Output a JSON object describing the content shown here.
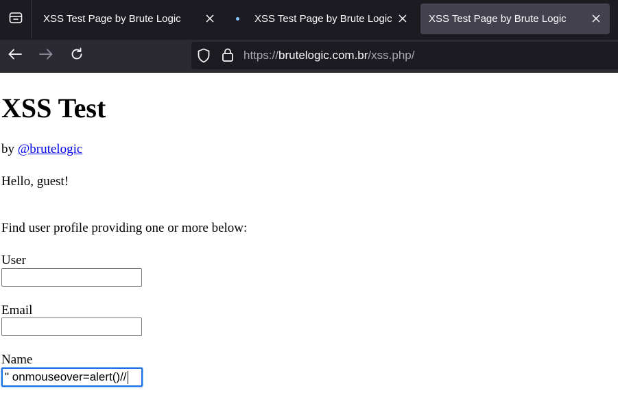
{
  "browser": {
    "tabs": [
      {
        "title": "XSS Test Page by Brute Logic",
        "active": false
      },
      {
        "title": "XSS Test Page by Brute Logic",
        "active": false
      },
      {
        "title": "XSS Test Page by Brute Logic",
        "active": true
      }
    ],
    "url": {
      "scheme": "https://",
      "host": "brutelogic.com.br",
      "path": "/xss.php/"
    }
  },
  "page": {
    "heading": "XSS Test",
    "by_prefix": "by ",
    "author_link": "@brutelogic",
    "greeting": "Hello, guest!",
    "instructions": "Find user profile providing one or more below:",
    "fields": {
      "user": {
        "label": "User",
        "value": ""
      },
      "email": {
        "label": "Email",
        "value": ""
      },
      "name": {
        "label": "Name",
        "value": "\" onmouseover=alert()//"
      }
    }
  }
}
